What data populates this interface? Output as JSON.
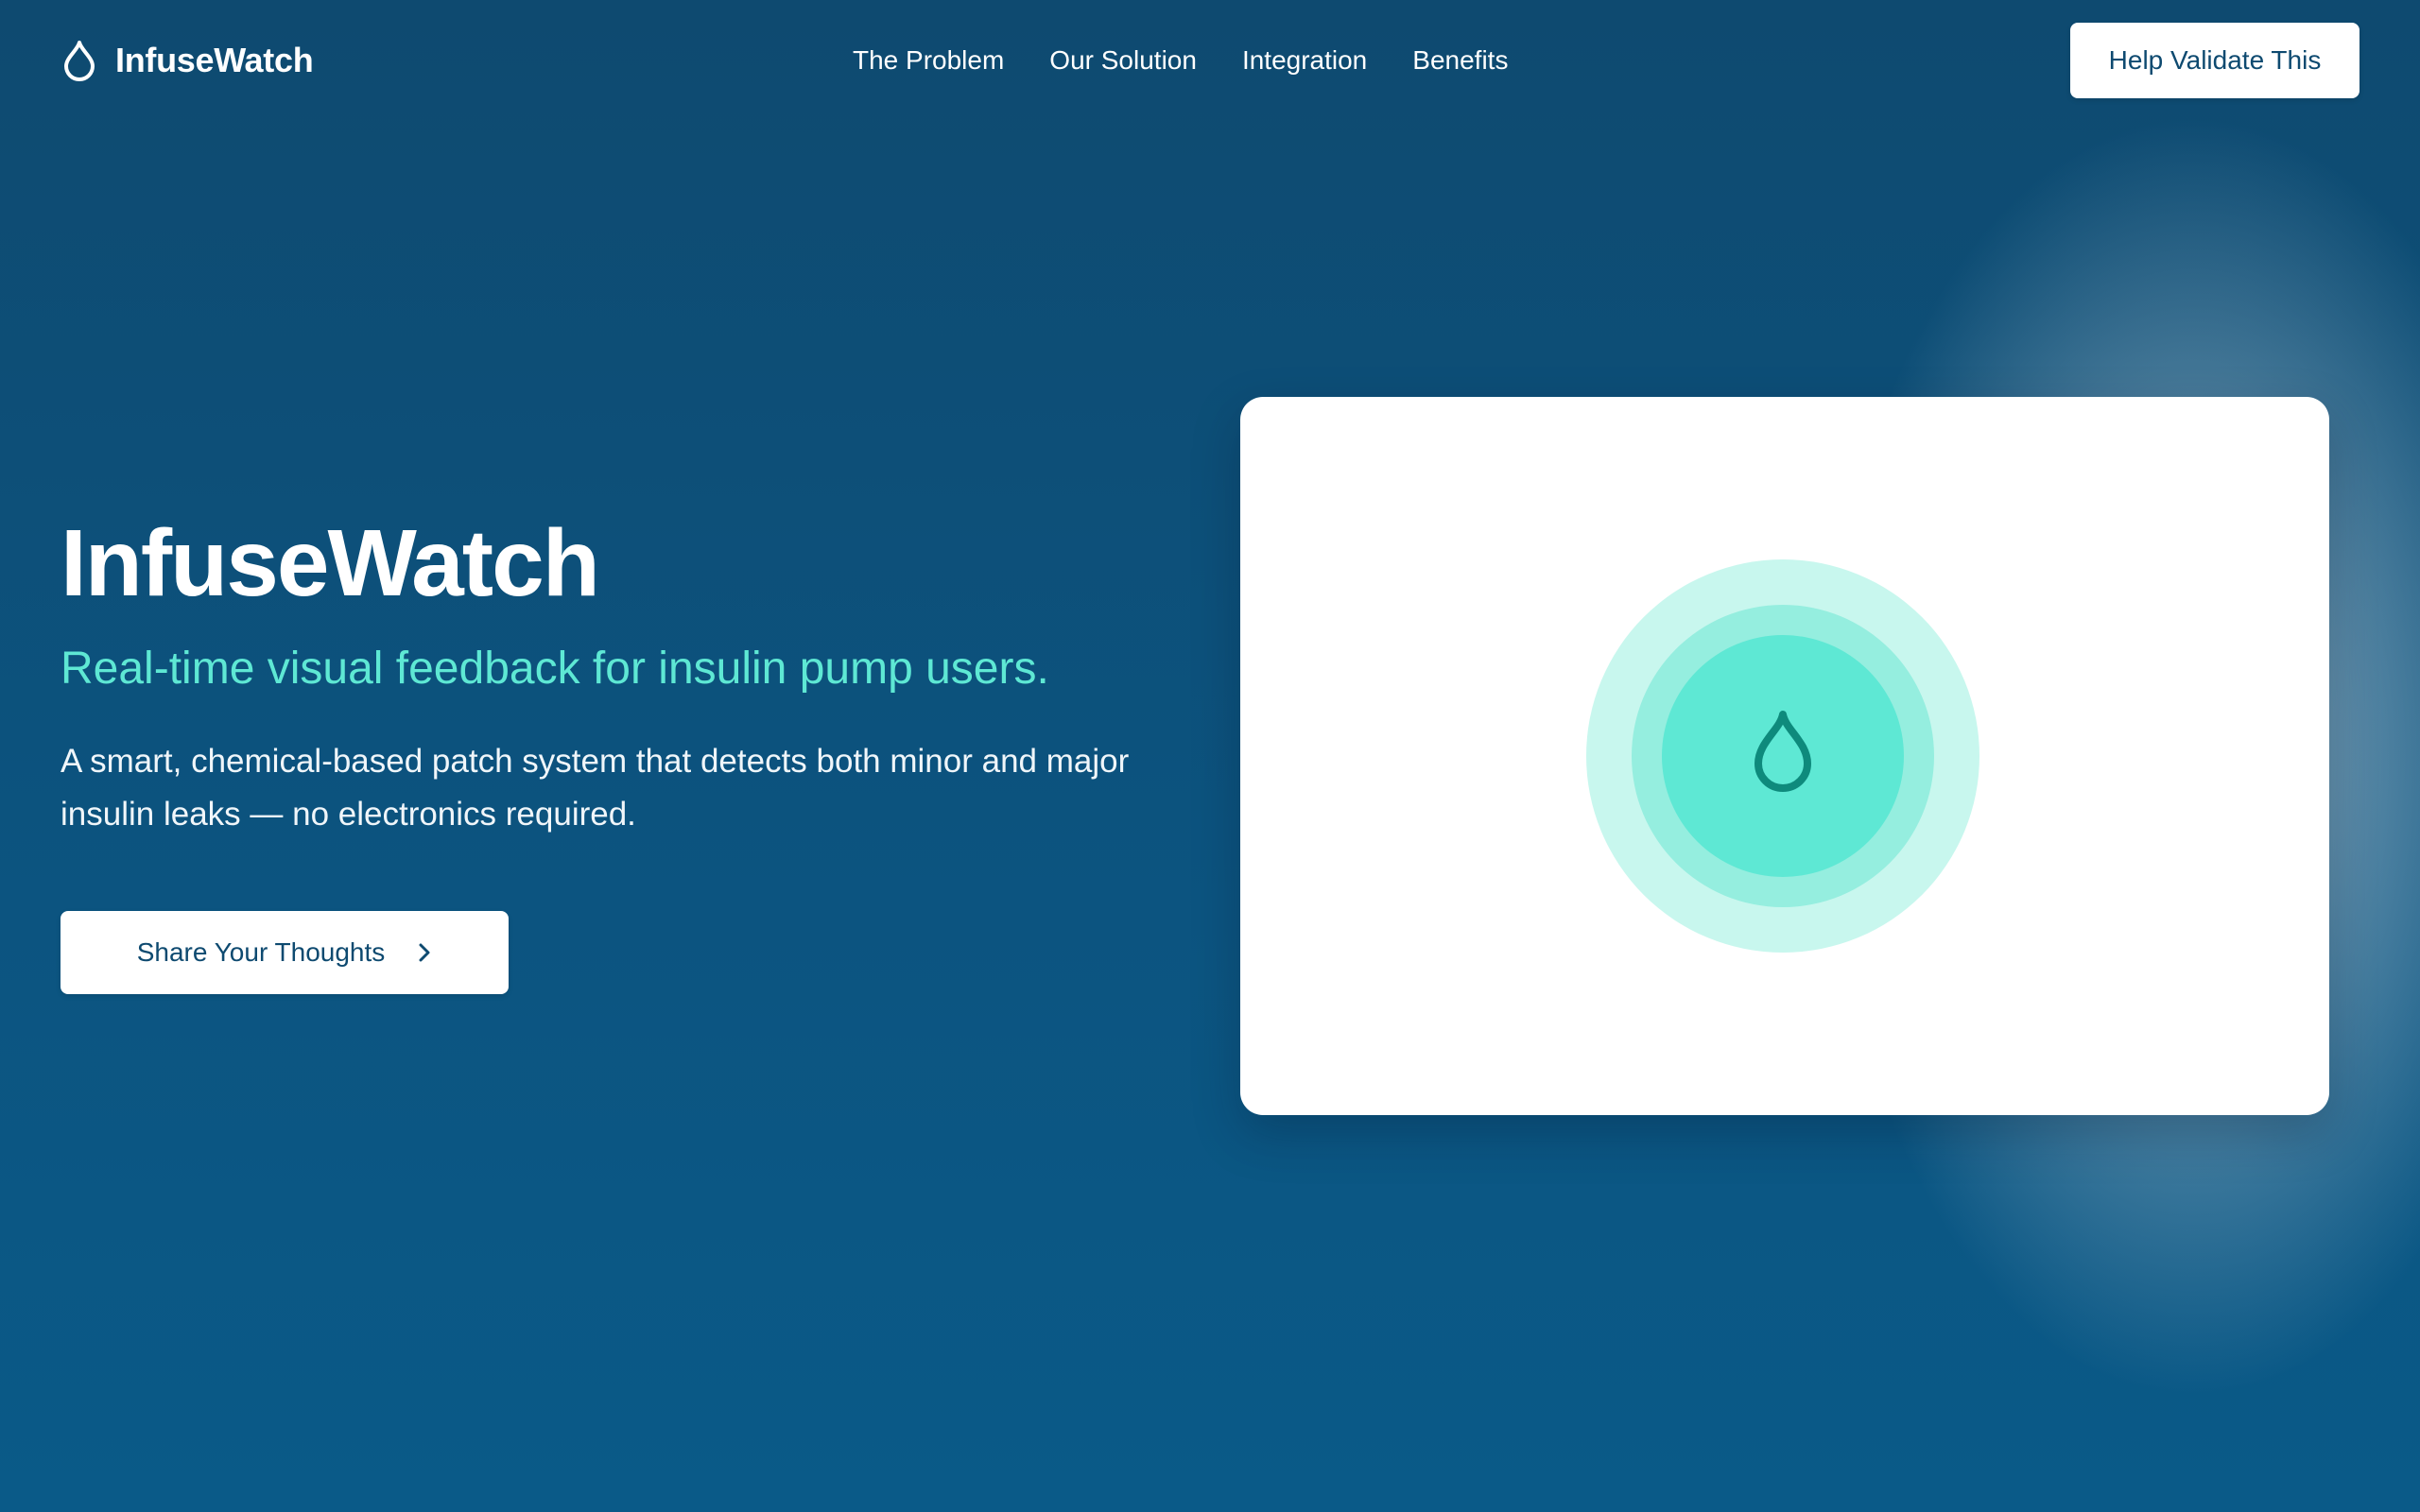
{
  "nav": {
    "brand": "InfuseWatch",
    "brand_icon": "droplet-icon",
    "links": [
      "The Problem",
      "Our Solution",
      "Integration",
      "Benefits"
    ],
    "cta_label": "Help Validate This"
  },
  "hero": {
    "title": "InfuseWatch",
    "subtitle": "Real-time visual feedback for insulin pump users.",
    "description": "A smart, chemical-based patch system that detects both minor and major insulin leaks — no electronics required.",
    "cta_label": "Share Your Thoughts",
    "cta_icon": "chevron-right-icon"
  },
  "illustration": {
    "icon": "droplet-icon"
  },
  "colors": {
    "background": "#0e4a70",
    "accent": "#5ee8d4",
    "button_text": "#0e4a70",
    "card": "#ffffff",
    "ring_outer": "#c8f7ee",
    "ring_mid": "#95eedf",
    "ring_inner": "#5ee8d4",
    "drop_stroke": "#0e8a7c"
  }
}
